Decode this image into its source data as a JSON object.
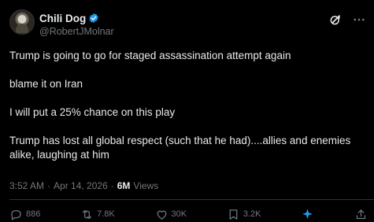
{
  "author": {
    "display_name": "Chili Dog",
    "handle": "@RobertJMolnar"
  },
  "tweet": {
    "paragraphs": [
      "Trump is going to go for staged assassination attempt again",
      "blame it on Iran",
      "I will put a 25% chance on this play",
      "Trump has lost all global respect (such that he had)....allies and enemies alike, laughing at him"
    ]
  },
  "meta": {
    "time": "3:52 AM",
    "separator1": "·",
    "date": "Apr 14, 2026",
    "separator2": "·",
    "views_count": "6M",
    "views_label": "Views"
  },
  "actions": {
    "replies": "886",
    "reposts": "7.8K",
    "likes": "30K",
    "bookmarks": "3.2K"
  },
  "colors": {
    "background": "#000000",
    "text": "#e7e9ea",
    "muted": "#71767b",
    "verified": "#1d9bf0",
    "divider": "#2f3336"
  },
  "icons": {
    "verified": "verified-badge-icon",
    "grok": "grok-icon",
    "more": "more-icon",
    "reply": "reply-icon",
    "repost": "repost-icon",
    "like": "like-icon",
    "bookmark": "bookmark-icon",
    "share": "share-icon"
  }
}
